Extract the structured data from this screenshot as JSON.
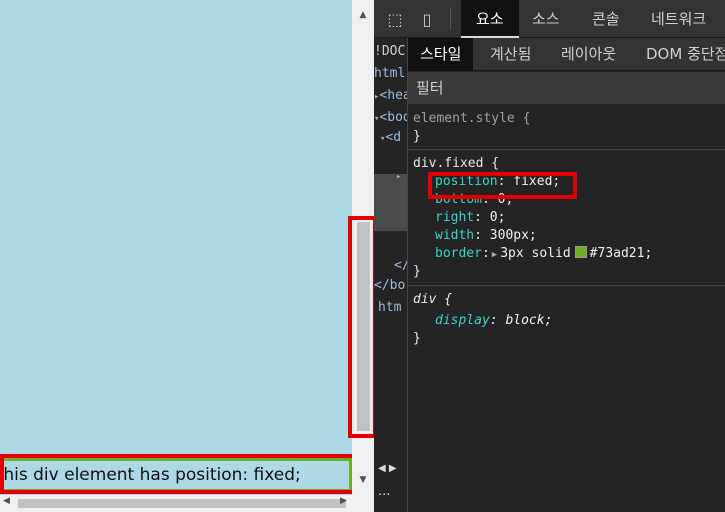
{
  "viewport": {
    "fixed_text": "This div element has position: fixed;",
    "background": "#add8e6",
    "border_color": "#73ad21"
  },
  "scrollbars": {
    "up_arrow": "▲",
    "down_arrow": "▼",
    "left_arrow": "◀",
    "right_arrow": "▶"
  },
  "devtools": {
    "icons": {
      "inspect": "⬚",
      "device": "▯"
    },
    "tabs": [
      "요소",
      "소스",
      "콘솔",
      "네트워크"
    ],
    "active_tab": "요소",
    "dom_lines": [
      "!DOC",
      "html",
      "<hea",
      "<bod",
      "<d",
      "▸",
      "</",
      "</bo",
      "htm"
    ],
    "dom_prefix": {
      "head": "▸",
      "body": "▾",
      "div": "▾"
    },
    "bottom_controls": "◀ ▶",
    "more": "···",
    "styles": {
      "sub_tabs": [
        "스타일",
        "계산됨",
        "레이아웃",
        "DOM 중단점"
      ],
      "active_sub_tab": "스타일",
      "filter_placeholder": "필터",
      "rules": [
        {
          "selector": "element.style {",
          "close": "}"
        },
        {
          "selector": "div.fixed {",
          "decls": [
            {
              "prop": "position",
              "value": "fixed;"
            },
            {
              "prop": "bottom",
              "value": "0;"
            },
            {
              "prop": "right",
              "value": "0;"
            },
            {
              "prop": "width",
              "value": "300px;"
            },
            {
              "prop": "border",
              "value": "3px solid",
              "color": "#73ad21",
              "value2": "#73ad21;"
            }
          ],
          "close": "}"
        },
        {
          "selector": "div {",
          "decls": [
            {
              "prop": "display",
              "value": "block;"
            }
          ],
          "close": "}"
        }
      ]
    }
  },
  "highlight_color": "#e20000"
}
